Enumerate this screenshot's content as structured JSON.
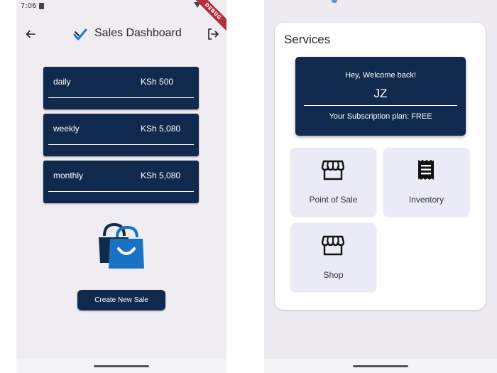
{
  "left_screen": {
    "status_time": "7:06",
    "debug_banner": "DEBUG",
    "app_title": "Sales Dashboard",
    "sales": [
      {
        "period": "daily",
        "amount": "KSh 500"
      },
      {
        "period": "weekly",
        "amount": "KSh 5,080"
      },
      {
        "period": "monthly",
        "amount": "KSh 5,080"
      }
    ],
    "create_button_label": "Create New Sale"
  },
  "right_screen": {
    "services_title": "Services",
    "welcome": {
      "greeting": "Hey, Welcome back!",
      "initials": "JZ",
      "plan": "Your Subscription plan: FREE"
    },
    "tiles": [
      {
        "label": "Point of Sale",
        "icon": "storefront-icon"
      },
      {
        "label": "Inventory",
        "icon": "receipt-icon"
      },
      {
        "label": "Shop",
        "icon": "storefront-icon"
      }
    ]
  },
  "colors": {
    "primary": "#0f2a4c",
    "bag": "#1a73c2",
    "tile_bg": "#ebebf7",
    "screen_bg": "#efedf2"
  }
}
